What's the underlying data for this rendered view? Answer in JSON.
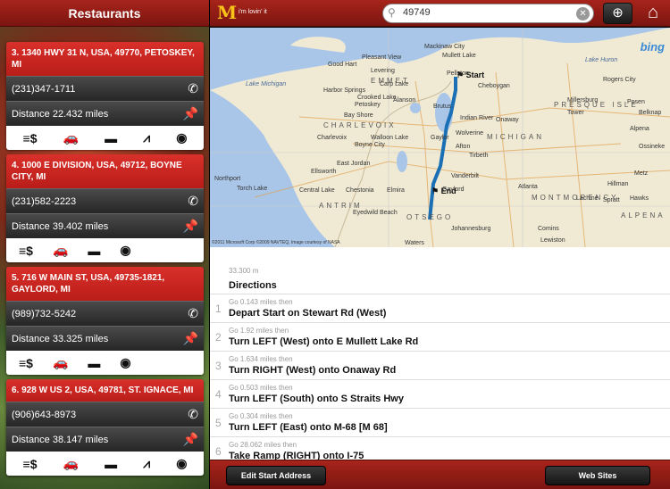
{
  "sidebar": {
    "title": "Restaurants",
    "cards": [
      {
        "title": "3. 1340 HWY 31 N, USA, 49770, PETOSKEY, MI",
        "phone": "(231)347-1711",
        "distance": "Distance 22.432 miles"
      },
      {
        "title": "4. 1000 E DIVISION, USA, 49712, BOYNE CITY, MI",
        "phone": "(231)582-2223",
        "distance": "Distance 39.402 miles"
      },
      {
        "title": "5. 716 W MAIN ST, USA, 49735-1821, GAYLORD, MI",
        "phone": "(989)732-5242",
        "distance": "Distance 33.325 miles"
      },
      {
        "title": "6. 928 W US 2, USA, 49781, ST. IGNACE, MI",
        "phone": "(906)643-8973",
        "distance": "Distance 38.147 miles"
      }
    ],
    "icons": {
      "phone": "phone-icon",
      "pin": "pushpin-icon",
      "dollar": "dollar-icon",
      "car": "drive-thru-icon",
      "card": "credit-card-icon",
      "playground": "playground-icon",
      "wifi": "wifi-icon"
    }
  },
  "topbar": {
    "logo": "M",
    "tagline": "i'm lovin' it",
    "search_value": "49749",
    "search_placeholder": "Search"
  },
  "map": {
    "bing": "bing",
    "copyright": "©2011 Microsoft Corp ©2009 NAVTEQ, Image courtesy of NASA",
    "start_label": "Start",
    "end_label": "End",
    "labels": [
      {
        "t": "Lake Huron",
        "c": "water"
      },
      {
        "t": "Lake Michigan",
        "c": "water"
      },
      {
        "t": "Mackinaw City",
        "c": ""
      },
      {
        "t": "Mullett Lake",
        "c": ""
      },
      {
        "t": "Pleasant View",
        "c": ""
      },
      {
        "t": "Good Hart",
        "c": ""
      },
      {
        "t": "Levering",
        "c": ""
      },
      {
        "t": "Carp Lake",
        "c": ""
      },
      {
        "t": "Harbor Springs",
        "c": ""
      },
      {
        "t": "Crooked Lake",
        "c": ""
      },
      {
        "t": "Petoskey",
        "c": ""
      },
      {
        "t": "Bay Shore",
        "c": ""
      },
      {
        "t": "Alanson",
        "c": ""
      },
      {
        "t": "Charlevoix",
        "c": ""
      },
      {
        "t": "Boyne City",
        "c": ""
      },
      {
        "t": "Walloon Lake",
        "c": ""
      },
      {
        "t": "East Jordan",
        "c": ""
      },
      {
        "t": "Ellsworth",
        "c": ""
      },
      {
        "t": "Central Lake",
        "c": ""
      },
      {
        "t": "Chestonia",
        "c": ""
      },
      {
        "t": "Elmira",
        "c": ""
      },
      {
        "t": "Torch Lake",
        "c": ""
      },
      {
        "t": "Northport",
        "c": ""
      },
      {
        "t": "Eyedwild Beach",
        "c": ""
      },
      {
        "t": "Gaylord",
        "c": ""
      },
      {
        "t": "Waters",
        "c": ""
      },
      {
        "t": "Johannesburg",
        "c": ""
      },
      {
        "t": "Vanderbilt",
        "c": ""
      },
      {
        "t": "Wolverine",
        "c": ""
      },
      {
        "t": "Indian River",
        "c": ""
      },
      {
        "t": "Cheboygan",
        "c": ""
      },
      {
        "t": "Onaway",
        "c": ""
      },
      {
        "t": "Millersburg",
        "c": ""
      },
      {
        "t": "Rogers City",
        "c": ""
      },
      {
        "t": "Posen",
        "c": ""
      },
      {
        "t": "Belknap",
        "c": ""
      },
      {
        "t": "Alpena",
        "c": ""
      },
      {
        "t": "Atlanta",
        "c": ""
      },
      {
        "t": "Hillman",
        "c": ""
      },
      {
        "t": "Lewiston",
        "c": ""
      },
      {
        "t": "Comins",
        "c": ""
      },
      {
        "t": "Lachine",
        "c": ""
      },
      {
        "t": "Spratt",
        "c": ""
      },
      {
        "t": "Hawks",
        "c": ""
      },
      {
        "t": "Metz",
        "c": ""
      },
      {
        "t": "Ossineke",
        "c": ""
      },
      {
        "t": "Tower",
        "c": ""
      },
      {
        "t": "Pellston",
        "c": ""
      },
      {
        "t": "Brutus",
        "c": ""
      },
      {
        "t": "Afton",
        "c": ""
      },
      {
        "t": "Tirbeth",
        "c": ""
      },
      {
        "t": "Gaylor",
        "c": ""
      },
      {
        "t": "MICHIGAN",
        "c": "big"
      },
      {
        "t": "EMMET",
        "c": "big"
      },
      {
        "t": "CHARLEVOIX",
        "c": "big"
      },
      {
        "t": "ANTRIM",
        "c": "big"
      },
      {
        "t": "OTSEGO",
        "c": "big"
      },
      {
        "t": "MONTMORENCY",
        "c": "big"
      },
      {
        "t": "PRESQUE ISLE",
        "c": "big"
      },
      {
        "t": "ALPENA",
        "c": "big"
      }
    ]
  },
  "directions": {
    "total": "33.300 m",
    "heading": "Directions",
    "steps": [
      {
        "num": "1",
        "go": "Go 0.143 miles then",
        "ins": "Depart Start on Stewart Rd (West)"
      },
      {
        "num": "2",
        "go": "Go 1.92 miles then",
        "ins": "Turn LEFT (West) onto E Mullett Lake Rd"
      },
      {
        "num": "3",
        "go": "Go 1.634 miles then",
        "ins": "Turn RIGHT (West) onto Onaway Rd"
      },
      {
        "num": "4",
        "go": "Go 0.503 miles then",
        "ins": "Turn LEFT (South) onto S Straits Hwy"
      },
      {
        "num": "5",
        "go": "Go 0.304 miles then",
        "ins": "Turn LEFT (East) onto M-68 [M 68]"
      },
      {
        "num": "6",
        "go": "Go 28.062 miles then",
        "ins": "Take Ramp (RIGHT) onto I-75"
      }
    ]
  },
  "bottombar": {
    "edit_label": "Edit Start Address",
    "web_label": "Web Sites"
  },
  "colors": {
    "brand_red": "#a7241b",
    "route_blue": "#1a6fb5",
    "logo_yellow": "#f7c31a"
  }
}
